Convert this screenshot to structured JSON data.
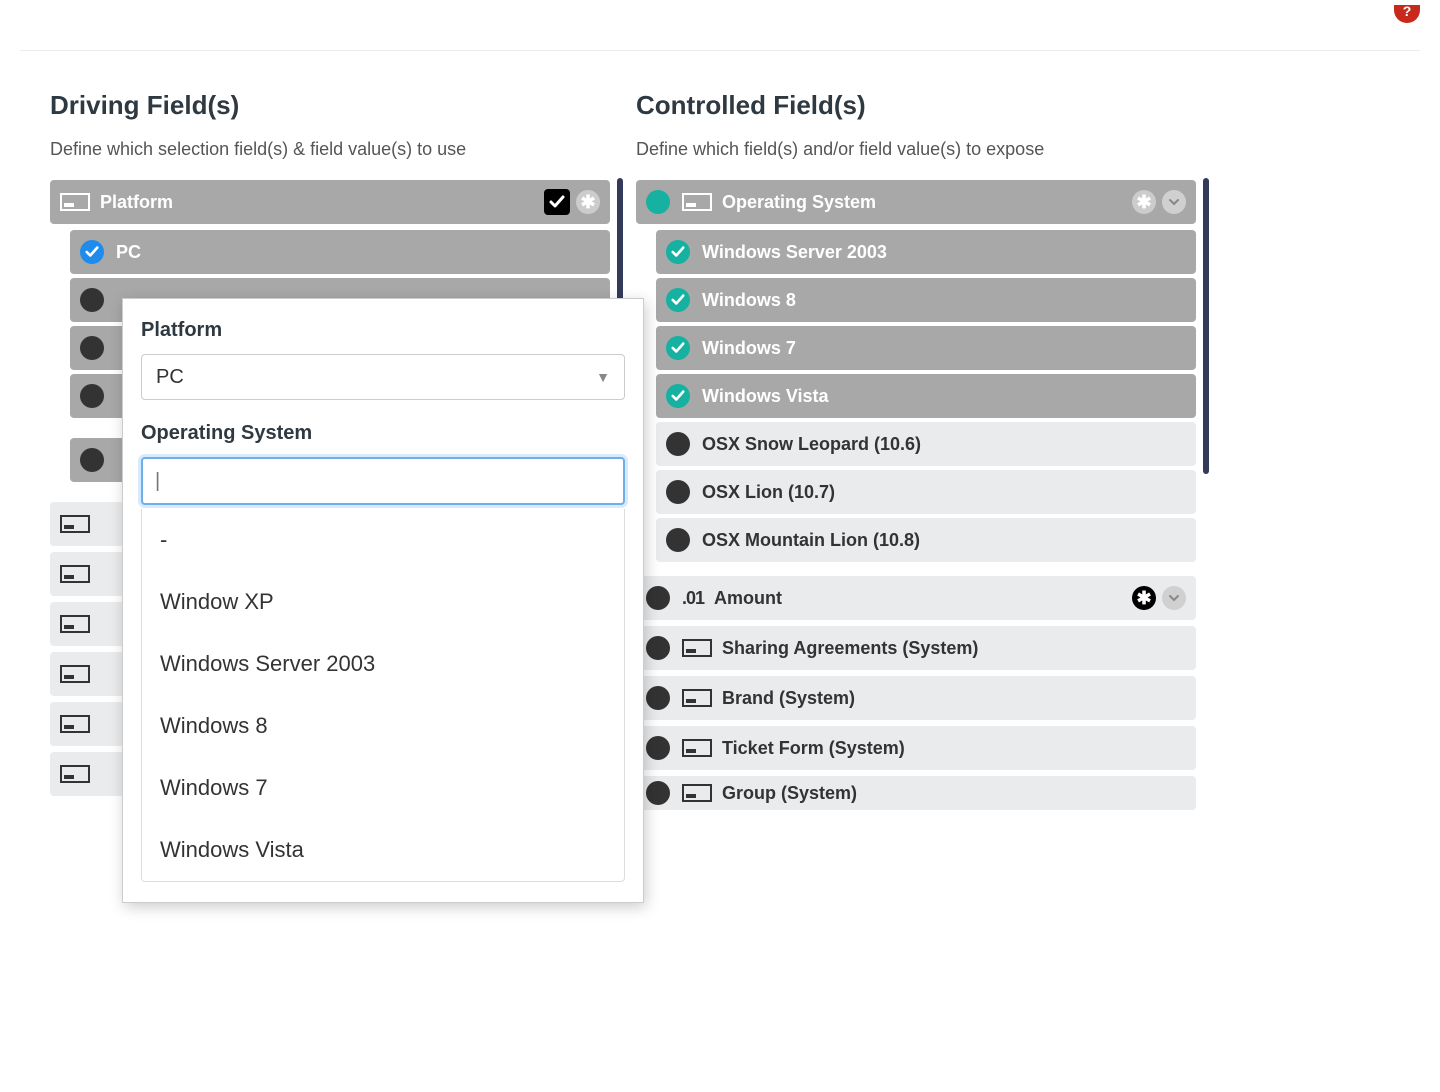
{
  "helpIcon": "?",
  "driving": {
    "title": "Driving Field(s)",
    "subtitle": "Define which selection field(s) & field value(s) to use",
    "platformHeader": "Platform",
    "pcValue": "PC"
  },
  "controlled": {
    "title": "Controlled Field(s)",
    "subtitle": "Define which field(s) and/or field value(s) to expose",
    "osHeader": "Operating System",
    "osValues": {
      "0": "Windows Server 2003",
      "1": "Windows 8",
      "2": "Windows 7",
      "3": "Windows Vista",
      "4": "OSX Snow Leopard (10.6)",
      "5": "OSX Lion (10.7)",
      "6": "OSX Mountain Lion (10.8)"
    },
    "amount": {
      "iconText": ".01",
      "label": "Amount"
    },
    "fields": {
      "0": "Sharing Agreements (System)",
      "1": "Brand (System)",
      "2": "Ticket Form (System)",
      "3": "Group (System)"
    }
  },
  "popup": {
    "platformLabel": "Platform",
    "platformValue": "PC",
    "osLabel": "Operating System",
    "osInput": "",
    "osInputCursor": "|",
    "options": {
      "0": "-",
      "1": "Window XP",
      "2": "Windows Server 2003",
      "3": "Windows 8",
      "4": "Windows 7",
      "5": "Windows Vista"
    }
  }
}
